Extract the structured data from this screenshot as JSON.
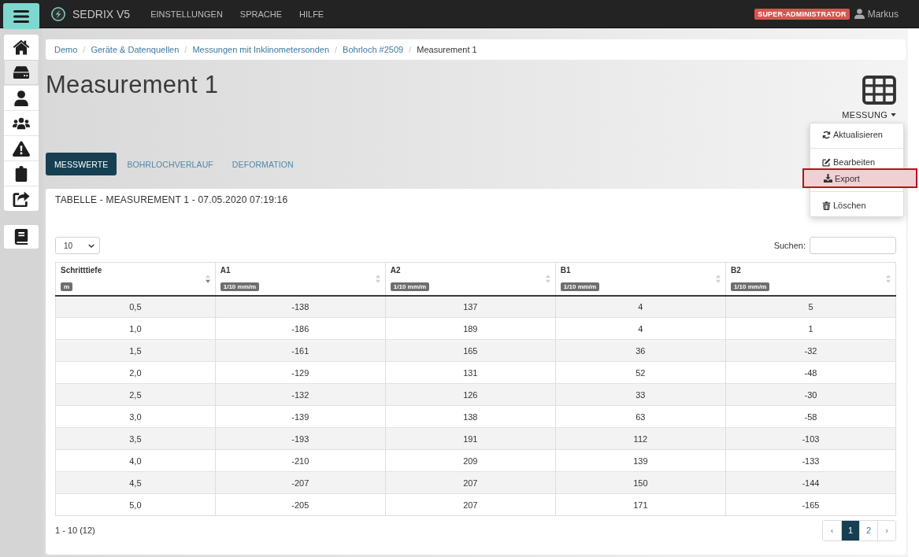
{
  "navbar": {
    "brand": "SEDRIX V5",
    "links": [
      {
        "label": "EINSTELLUNGEN"
      },
      {
        "label": "SPRACHE"
      },
      {
        "label": "HILFE"
      }
    ],
    "role_badge": "SUPER-ADMINISTRATOR",
    "user": "Markus"
  },
  "sidebar": {
    "groups": [
      {
        "items": [
          {
            "selected": false
          },
          {
            "selected": true
          },
          {
            "selected": false
          },
          {
            "selected": false
          },
          {
            "selected": false
          },
          {
            "selected": false
          },
          {
            "selected": false
          }
        ]
      },
      {
        "items": [
          {
            "selected": false
          }
        ]
      }
    ]
  },
  "breadcrumb": {
    "separator": "/",
    "items": [
      {
        "label": "Demo",
        "current": false
      },
      {
        "label": "Geräte & Datenquellen",
        "current": false
      },
      {
        "label": "Messungen mit Inklinometersonden",
        "current": false
      },
      {
        "label": "Bohrloch #2509",
        "current": false
      },
      {
        "label": "Measurement 1",
        "current": true
      }
    ]
  },
  "page_title": "Measurement 1",
  "measurement_menu": {
    "label": "MESSUNG",
    "expanded": true,
    "items": [
      {
        "kind": "action",
        "label": "Aktualisieren",
        "highlighted": false
      },
      {
        "kind": "divider"
      },
      {
        "kind": "action",
        "label": "Bearbeiten",
        "highlighted": false
      },
      {
        "kind": "action",
        "label": "Export",
        "highlighted": true
      },
      {
        "kind": "divider"
      },
      {
        "kind": "action",
        "label": "Löschen",
        "highlighted": false
      }
    ]
  },
  "tabs": [
    {
      "label": "MESSWERTE",
      "selected": true
    },
    {
      "label": "BOHRLOCHVERLAUF",
      "selected": false
    },
    {
      "label": "DEFORMATION",
      "selected": false
    }
  ],
  "table_card": {
    "title": "TABELLE - MEASUREMENT 1 - 07.05.2020 07:19:16",
    "page_length": "10",
    "search_label": "Suchen:",
    "columns": [
      {
        "name": "Schritttiefe",
        "unit": "m",
        "sorted": true
      },
      {
        "name": "A1",
        "unit": "1/10 mm/m",
        "sorted": false
      },
      {
        "name": "A2",
        "unit": "1/10 mm/m",
        "sorted": false
      },
      {
        "name": "B1",
        "unit": "1/10 mm/m",
        "sorted": false
      },
      {
        "name": "B2",
        "unit": "1/10 mm/m",
        "sorted": false
      }
    ],
    "rows": [
      [
        "0,5",
        "-138",
        "137",
        "4",
        "5"
      ],
      [
        "1,0",
        "-186",
        "189",
        "4",
        "1"
      ],
      [
        "1,5",
        "-161",
        "165",
        "36",
        "-32"
      ],
      [
        "2,0",
        "-129",
        "131",
        "52",
        "-48"
      ],
      [
        "2,5",
        "-132",
        "126",
        "33",
        "-30"
      ],
      [
        "3,0",
        "-139",
        "138",
        "63",
        "-58"
      ],
      [
        "3,5",
        "-193",
        "191",
        "112",
        "-103"
      ],
      [
        "4,0",
        "-210",
        "209",
        "139",
        "-133"
      ],
      [
        "4,5",
        "-207",
        "207",
        "150",
        "-144"
      ],
      [
        "5,0",
        "-205",
        "207",
        "171",
        "-165"
      ]
    ],
    "info": "1 - 10 (12)",
    "pagination": [
      {
        "label": "‹",
        "selected": false
      },
      {
        "label": "1",
        "selected": true
      },
      {
        "label": "2",
        "selected": false
      },
      {
        "label": "›",
        "selected": false
      }
    ]
  }
}
